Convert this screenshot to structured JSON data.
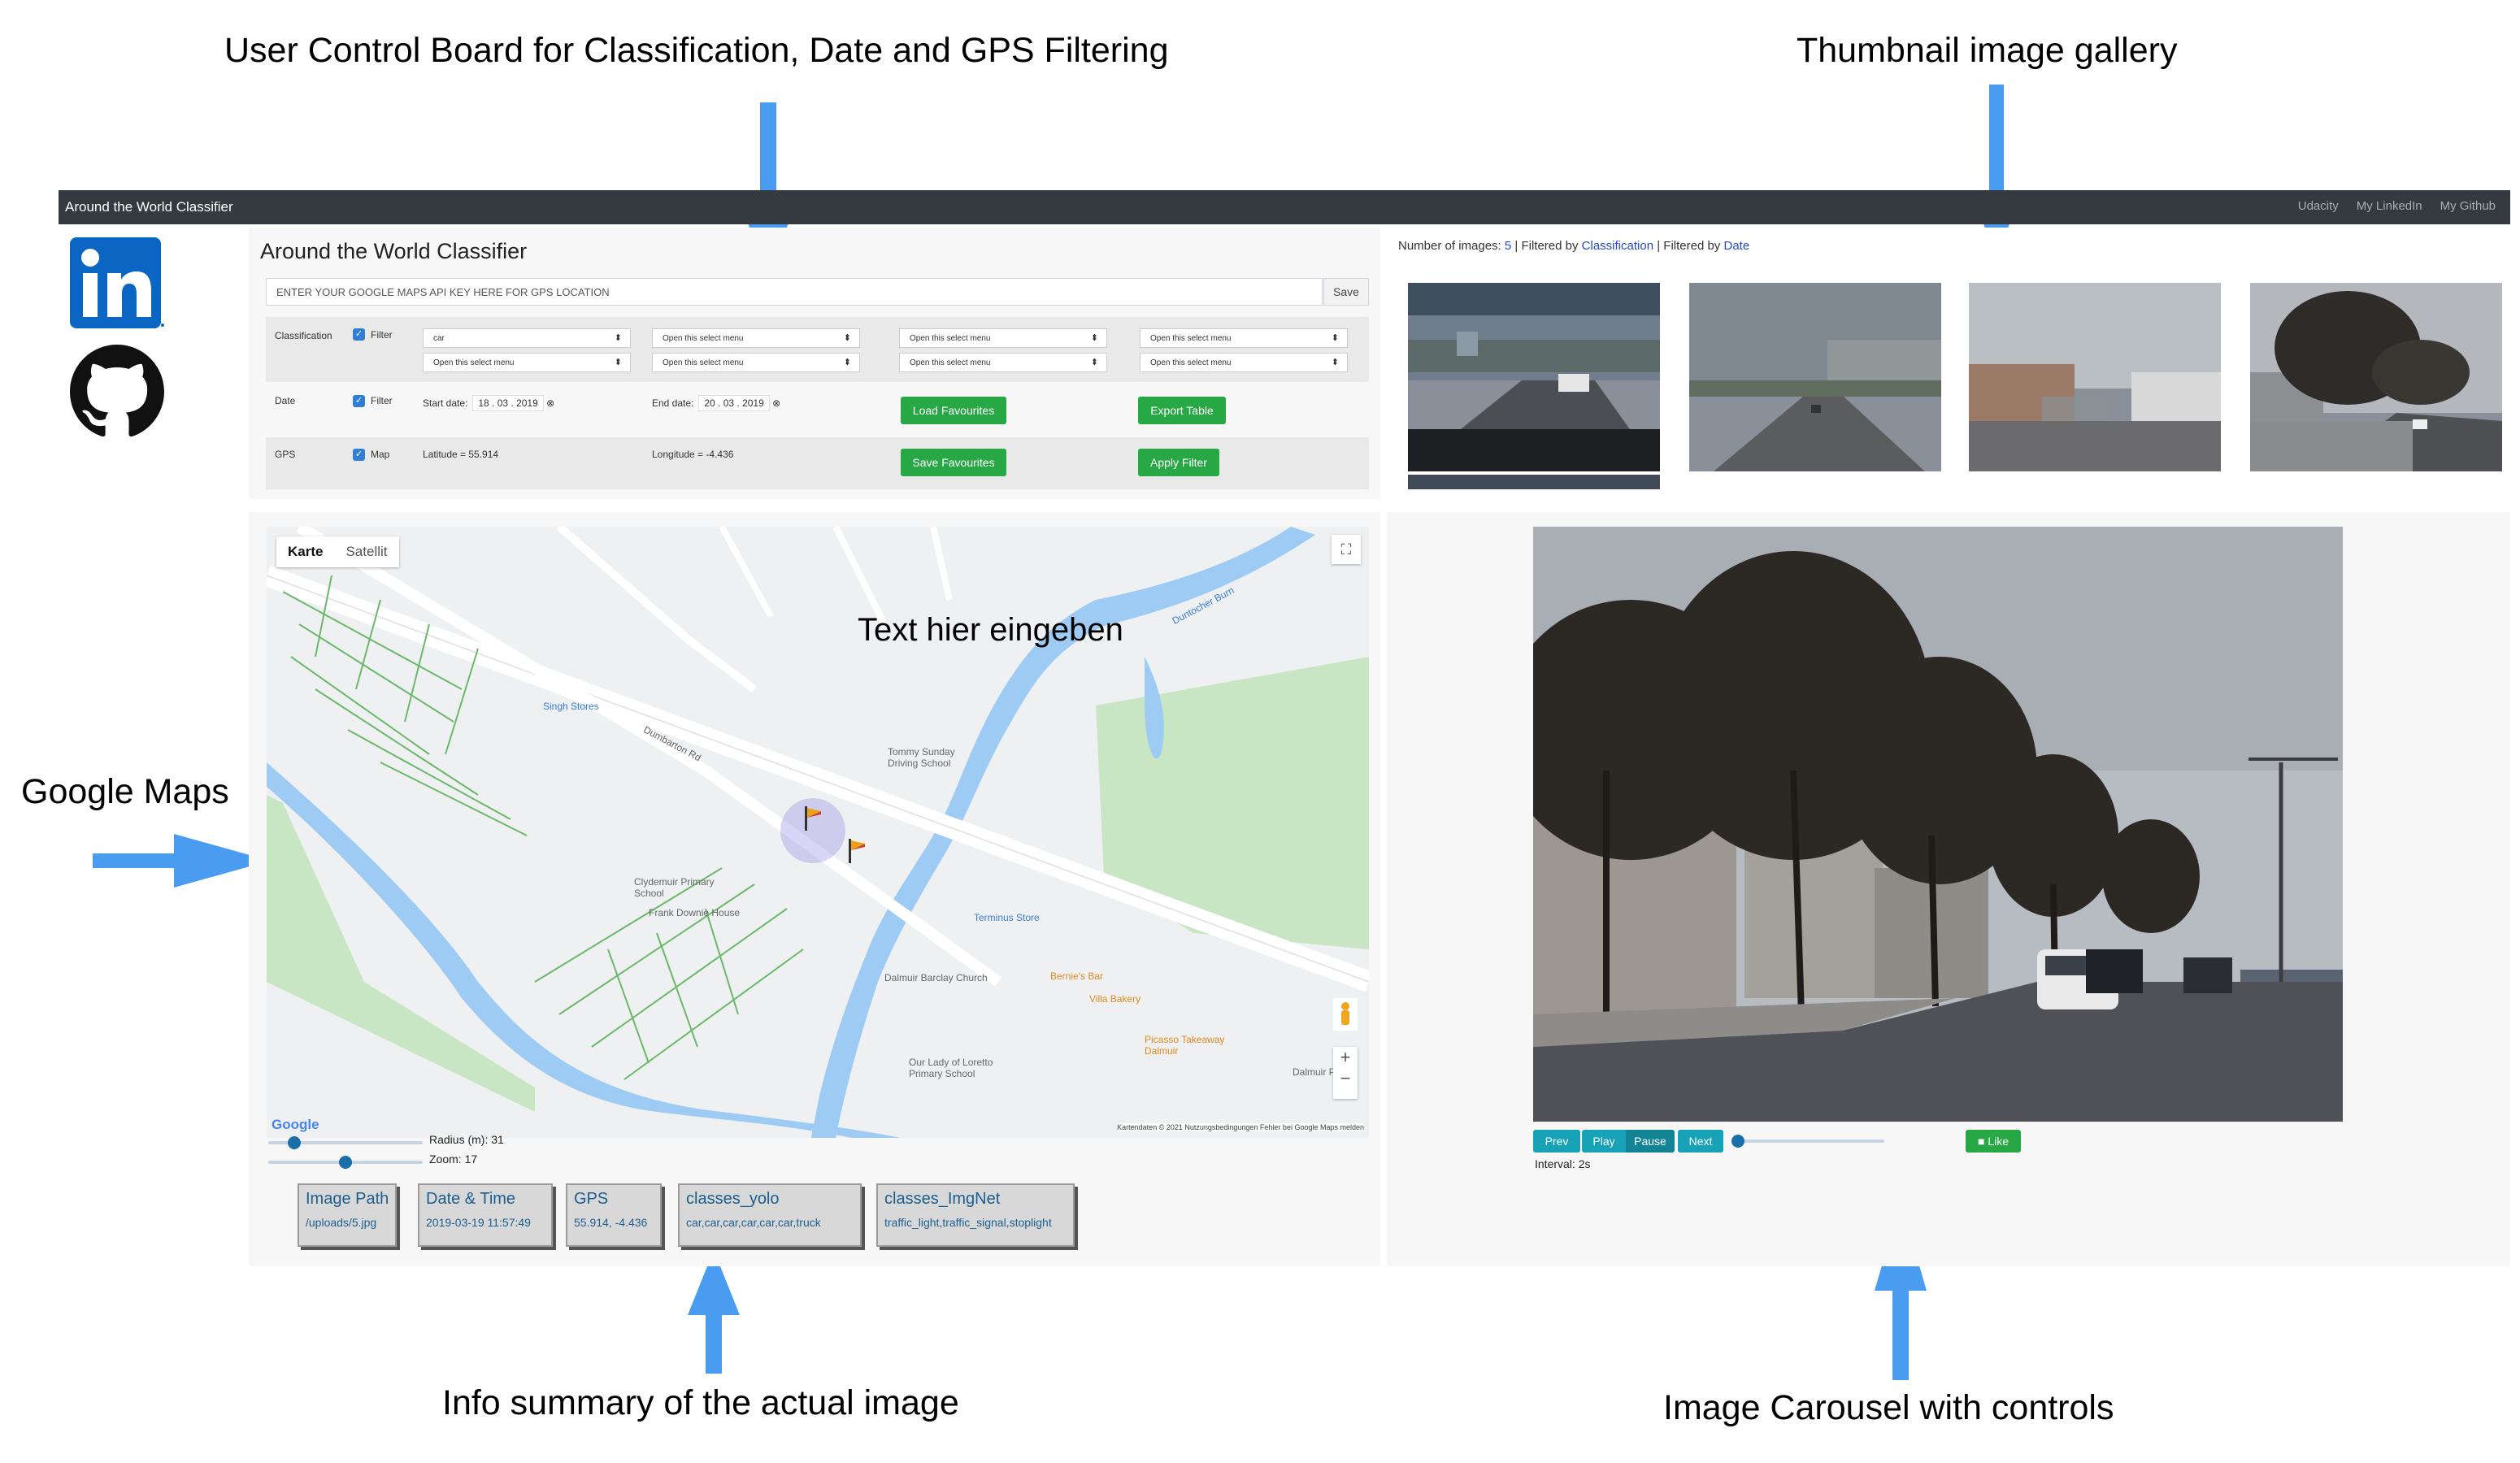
{
  "annotations": {
    "control_board": "User Control Board for Classification, Date and GPS Filtering",
    "gallery": "Thumbnail image gallery",
    "maps": "Google Maps",
    "info": "Info summary of the actual image",
    "carousel": "Image Carousel with controls"
  },
  "navbar": {
    "brand": "Around the World Classifier",
    "links": [
      "Udacity",
      "My LinkedIn",
      "My Github"
    ]
  },
  "social": {
    "linkedin_icon": "linkedin-icon",
    "github_icon": "github-icon"
  },
  "control": {
    "title": "Around the World Classifier",
    "api_placeholder": "ENTER YOUR GOOGLE MAPS API KEY HERE FOR GPS LOCATION",
    "save_label": "Save",
    "classification": {
      "label": "Classification",
      "filter_label": "Filter",
      "selects": [
        "car",
        "Open this select menu",
        "Open this select menu",
        "Open this select menu",
        "Open this select menu",
        "Open this select menu",
        "Open this select menu",
        "Open this select menu"
      ]
    },
    "date": {
      "label": "Date",
      "filter_label": "Filter",
      "start_label": "Start date:",
      "start_value": "18 . 03 . 2019",
      "end_label": "End date:",
      "end_value": "20 . 03 . 2019",
      "load_favourites": "Load Favourites",
      "export_table": "Export Table"
    },
    "gps": {
      "label": "GPS",
      "map_label": "Map",
      "latitude": "Latitude = 55.914",
      "longitude": "Longitude = -4.436",
      "save_favourites": "Save Favourites",
      "apply_filter": "Apply Filter"
    }
  },
  "gallery": {
    "count_prefix": "Number of images:",
    "count": "5",
    "sep1": "| Filtered by",
    "filter1": "Classification",
    "sep2": "| Filtered by",
    "filter2": "Date"
  },
  "map": {
    "tab_map": "Karte",
    "tab_sat": "Satellit",
    "overlay_text": "Text hier eingeben",
    "labels": [
      "Dumbarton Rd",
      "Singh Stores",
      "Tommy Sunday Driving School",
      "Clydemuir Primary School",
      "Frank Downie House",
      "Terminus Store",
      "Dalmuir Barclay Church",
      "Bernie's Bar",
      "Villa Bakery",
      "Picasso Takeaway Dalmuir",
      "Our Lady of Loretto Primary School",
      "Duntocher Burn",
      "Dalmuir Post"
    ],
    "attribution": "Kartendaten © 2021   Nutzungsbedingungen   Fehler bei Google Maps melden",
    "google_logo": "Google",
    "radius_label": "Radius (m): 31",
    "zoom_label": "Zoom: 17",
    "radius_fraction": 0.14,
    "zoom_fraction": 0.5
  },
  "info": [
    {
      "header": "Image Path",
      "value": "/uploads/5.jpg"
    },
    {
      "header": "Date & Time",
      "value": "2019-03-19 11:57:49"
    },
    {
      "header": "GPS",
      "value": "55.914, -4.436"
    },
    {
      "header": "classes_yolo",
      "value": "car,car,car,car,car,car,truck"
    },
    {
      "header": "classes_ImgNet",
      "value": "traffic_light,traffic_signal,stoplight"
    }
  ],
  "carousel": {
    "prev": "Prev",
    "play": "Play",
    "pause": "Pause",
    "next": "Next",
    "like": "Like",
    "interval": "Interval: 2s",
    "interval_fraction": 0.0
  },
  "colors": {
    "navbar": "#343a40",
    "green": "#28a745",
    "teal": "#17a2b8",
    "link_blue": "#2347d1",
    "water": "#9ecbf4",
    "park": "#c8e6c3"
  }
}
